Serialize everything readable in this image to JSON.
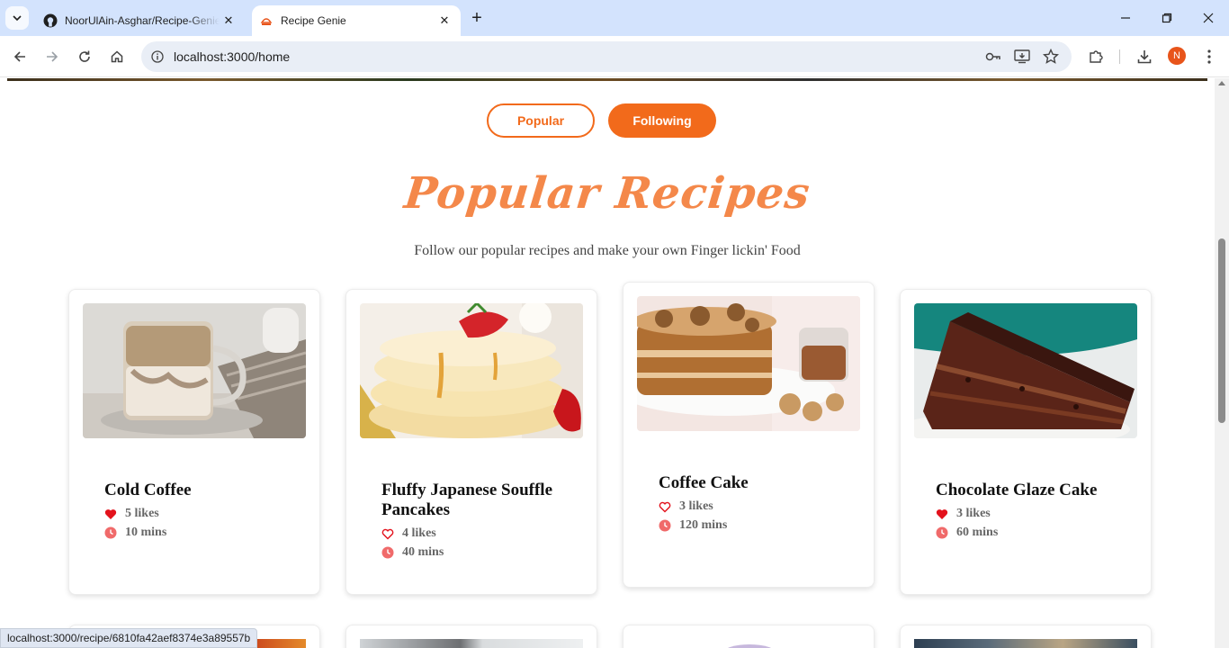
{
  "browser": {
    "tabs": [
      {
        "title": "NoorUlAin-Asghar/Recipe-Genie",
        "active": false
      },
      {
        "title": "Recipe Genie",
        "active": true
      }
    ],
    "url": "localhost:3000/home",
    "profile_initial": "N",
    "status_url": "localhost:3000/recipe/6810fa42aef8374e3a89557b"
  },
  "page": {
    "toggle": {
      "popular_label": "Popular",
      "following_label": "Following"
    },
    "title": "Popular Recipes",
    "subtitle": "Follow our popular recipes and make your own Finger lickin' Food",
    "accent_color": "#f26a1b",
    "recipes": [
      {
        "name": "Cold Coffee",
        "likes": "5 likes",
        "time": "10 mins",
        "liked": true
      },
      {
        "name": "Fluffy Japanese Souffle Pancakes",
        "likes": "4 likes",
        "time": "40 mins",
        "liked": false
      },
      {
        "name": "Coffee Cake",
        "likes": "3 likes",
        "time": "120 mins",
        "liked": false
      },
      {
        "name": "Chocolate Glaze Cake",
        "likes": "3 likes",
        "time": "60 mins",
        "liked": true
      }
    ]
  }
}
